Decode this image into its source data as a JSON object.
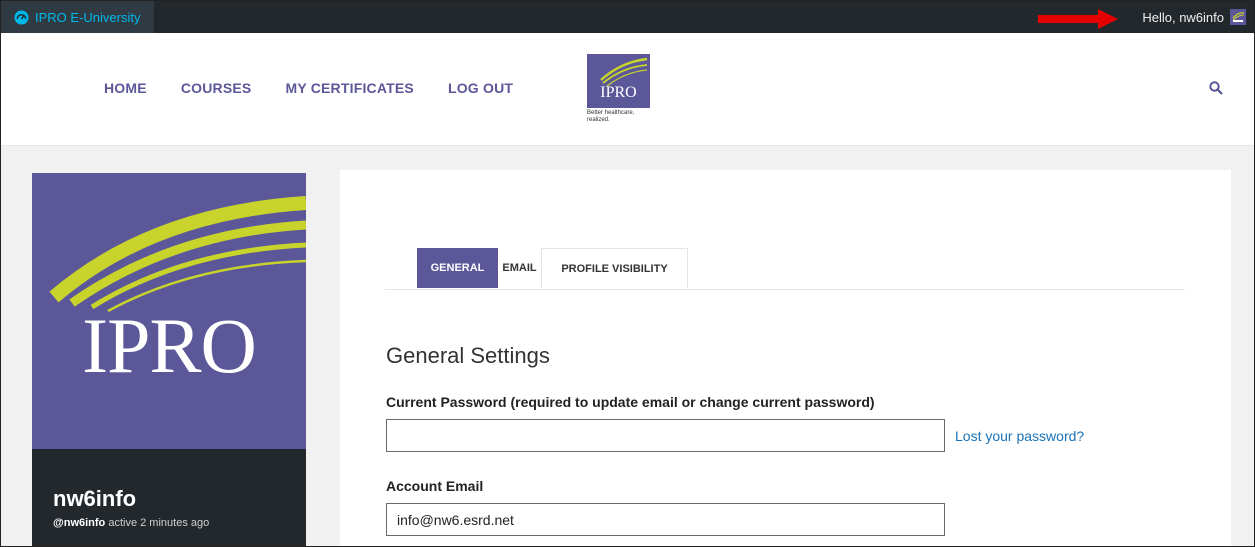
{
  "adminbar": {
    "site_name": "IPRO E-University",
    "greeting": "Hello, nw6info",
    "colors": {
      "bg": "#23282d",
      "site_bg": "#2f3a43",
      "link": "#00b9eb",
      "arrow": "#e60000"
    }
  },
  "header": {
    "nav": [
      "HOME",
      "COURSES",
      "MY CERTIFICATES",
      "LOG OUT"
    ],
    "logo_text": "IPRO",
    "tagline": "Better healthcare, realized.",
    "accent": "#5b5799"
  },
  "profile": {
    "image_text": "IPRO",
    "display_name": "nw6info",
    "handle": "@nw6info",
    "activity": "active 2 minutes ago"
  },
  "settings": {
    "tabs": [
      {
        "label": "GENERAL",
        "active": true
      },
      {
        "label": "EMAIL",
        "active": false
      },
      {
        "label": "PROFILE VISIBILITY",
        "active": false
      }
    ],
    "title": "General Settings",
    "password_label": "Current Password (required to update email or change current password)",
    "password_value": "",
    "lost_password": "Lost your password?",
    "email_label": "Account Email",
    "email_value": "info@nw6.esrd.net"
  }
}
